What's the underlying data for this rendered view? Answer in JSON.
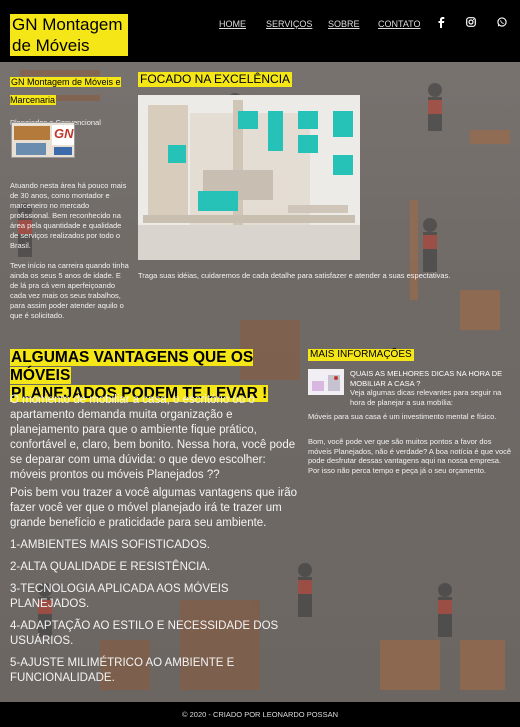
{
  "header": {
    "logo": "GN Montagem de Móveis",
    "nav": [
      "HOME",
      "SERVIÇOS",
      "SOBRE",
      "CONTATO"
    ],
    "social_icons": [
      "facebook-icon",
      "instagram-icon",
      "whatsapp-icon"
    ]
  },
  "left": {
    "title": "GN Montagem de Móveis e Marcenaria",
    "subtitle": "Planejados e Convencional",
    "badge_text": "GN",
    "about": "Atuando nesta área há pouco mais de 30 anos, como montador e marceneiro no mercado profissional. Bem reconhecido na área pela quantidade e qualidade de serviços realizados por todo o Brasil.",
    "history": "Teve início na carreira quando tinha ainda os seus 5 anos de idade. E de lá pra cá vem aperfeiçoando cada vez mais os seus trabalhos, para assim poder atender aquilo o que é solicitado."
  },
  "focus": {
    "title": "FOCADO NA EXCELÊNCIA",
    "caption": "Traga suas idéias, cuidaremos de cada detalhe para satisfazer e atender a suas espectativas."
  },
  "main": {
    "title": "ALGUMAS VANTAGENS QUE OS MÓVEIS PLANEJADOS PODEM TE LEVAR !",
    "title_line1": "ALGUMAS VANTAGENS QUE OS MÓVEIS",
    "title_line2": "PLANEJADOS PODEM TE LEVAR !",
    "p1": "O momento de mobiliar a casa, o escritório ou o apartamento demanda muita organização e planejamento para que o ambiente fique prático, confortável e, claro, bem bonito. Nessa hora, você pode se deparar com uma dúvida: o que devo escolher: móveis prontos ou móveis Planejados ??",
    "p2": "Pois bem vou trazer a você algumas vantagens que irão fazer você ver que o móvel planejado irá te trazer um grande benefício e praticidade para seu ambiente.",
    "items": [
      "1-AMBIENTES MAIS SOFISTICADOS.",
      "2-ALTA QUALIDADE E RESISTÊNCIA.",
      "3-TECNOLOGIA APLICADA AOS MÓVEIS PLANEJADOS.",
      "4-ADAPTAÇÃO AO ESTILO E NECESSIDADE DOS USUÁRIOS.",
      "5-AJUSTE MILIMÉTRICO AO AMBIENTE E FUNCIONALIDADE."
    ]
  },
  "more": {
    "title": "MAIS INFORMAÇÕES",
    "headline": "QUAIS AS MELHORES DICAS NA HORA DE MOBILIAR A CASA ?",
    "intro": "Veja algumas dicas relevantes para seguir na hora de planejar a sua mobília:",
    "p1": "Móveis para sua casa é um investimento mental e físico.",
    "p2": "Bom, você pode ver que são muitos pontos a favor dos móveis Planejados, não é verdade? A boa notícia é que você pode desfrutar dessas vantagens aqui na nossa empresa. Por isso não perca tempo e peça já o seu orçamento."
  },
  "footer": {
    "text": "© 2020 - CRIADO POR LEONARDO POSSAN"
  },
  "colors": {
    "highlight": "#f5e617",
    "header_bg": "#000000",
    "accent_red": "#c0392b"
  }
}
